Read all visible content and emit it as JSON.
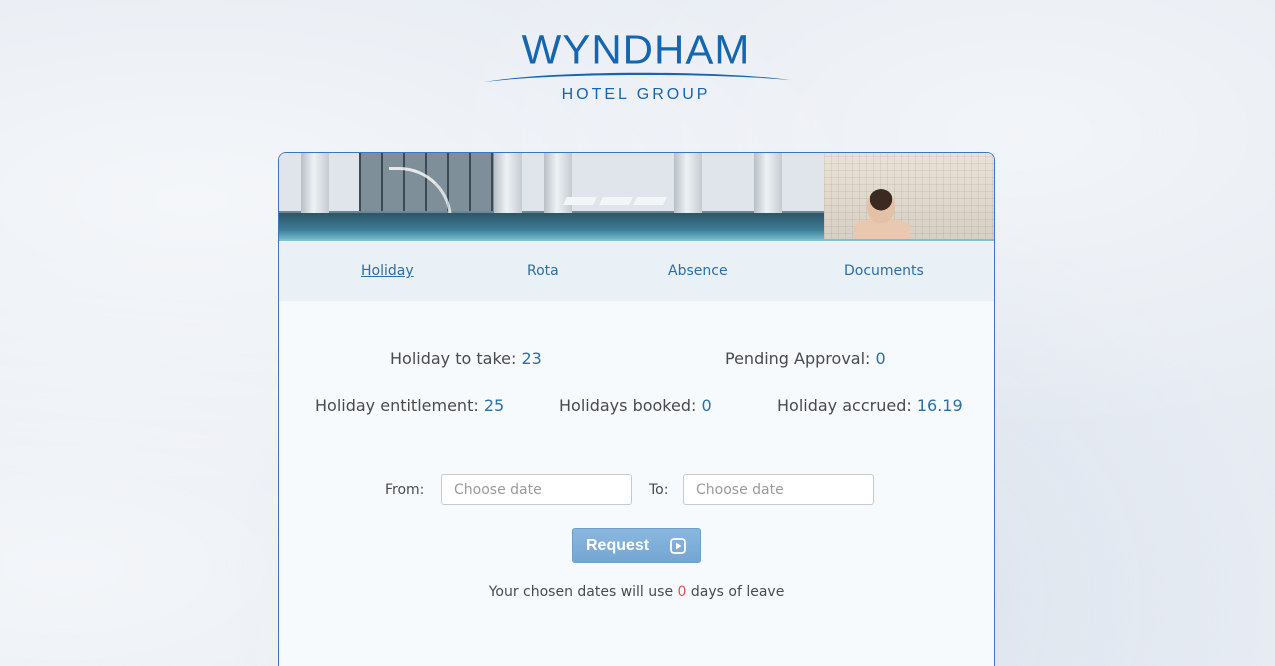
{
  "logo": {
    "name": "WYNDHAM",
    "subtitle": "HOTEL GROUP"
  },
  "nav": {
    "items": [
      {
        "label": "Holiday",
        "active": true
      },
      {
        "label": "Rota",
        "active": false
      },
      {
        "label": "Absence",
        "active": false
      },
      {
        "label": "Documents",
        "active": false
      }
    ]
  },
  "stats": {
    "holiday_to_take": {
      "label": "Holiday to take:",
      "value": "23"
    },
    "pending_approval": {
      "label": "Pending Approval:",
      "value": "0"
    },
    "holiday_entitlement": {
      "label": "Holiday entitlement:",
      "value": "25"
    },
    "holidays_booked": {
      "label": "Holidays booked:",
      "value": "0"
    },
    "holiday_accrued": {
      "label": "Holiday accrued:",
      "value": "16.19"
    }
  },
  "form": {
    "from_label": "From:",
    "from_placeholder": "Choose date",
    "from_value": "",
    "to_label": "To:",
    "to_placeholder": "Choose date",
    "to_value": "",
    "request_label": "Request",
    "request_icon": "play-square-icon"
  },
  "summary": {
    "prefix": "Your chosen dates will use",
    "days": "0",
    "suffix": "days of leave"
  },
  "colors": {
    "brand_blue": "#1566b0",
    "link_blue": "#2b6ea8",
    "button_blue": "#7eaed8",
    "days_red": "#d9534f"
  }
}
